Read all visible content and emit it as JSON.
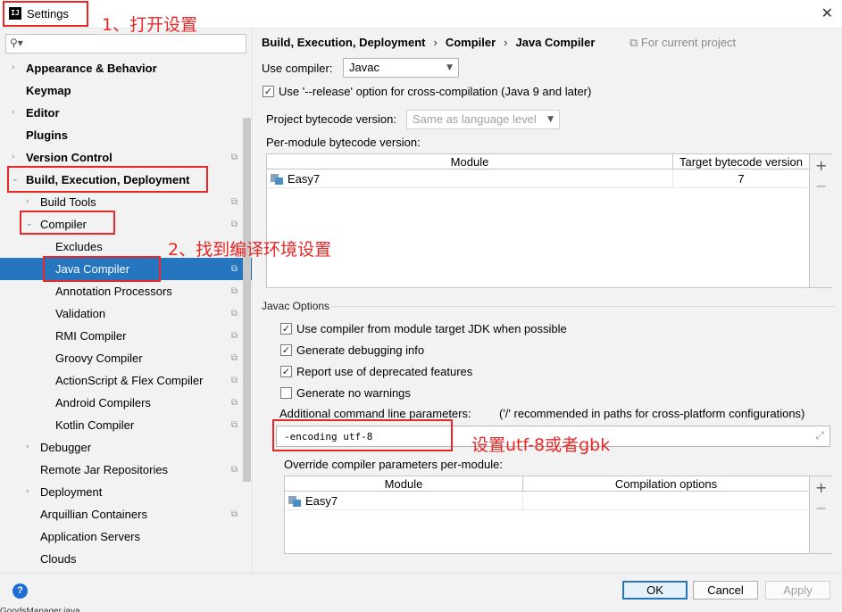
{
  "window": {
    "title": "Settings",
    "app_logo": "IJ",
    "close_glyph": "✕"
  },
  "search": {
    "placeholder": "",
    "icon": "search-icon"
  },
  "sidebar": {
    "items": [
      {
        "label": "Appearance & Behavior",
        "bold": true,
        "arrow": "›"
      },
      {
        "label": "Keymap",
        "bold": true
      },
      {
        "label": "Editor",
        "bold": true,
        "arrow": "›"
      },
      {
        "label": "Plugins",
        "bold": true
      },
      {
        "label": "Version Control",
        "bold": true,
        "arrow": "›"
      },
      {
        "label": "Build, Execution, Deployment",
        "bold": true,
        "arrow": "⌄"
      },
      {
        "label": "Build Tools",
        "arrow": "›"
      },
      {
        "label": "Compiler",
        "arrow": "⌄"
      },
      {
        "label": "Excludes"
      },
      {
        "label": "Java Compiler",
        "selected": true
      },
      {
        "label": "Annotation Processors"
      },
      {
        "label": "Validation"
      },
      {
        "label": "RMI Compiler"
      },
      {
        "label": "Groovy Compiler"
      },
      {
        "label": "ActionScript & Flex Compiler"
      },
      {
        "label": "Android Compilers"
      },
      {
        "label": "Kotlin Compiler"
      },
      {
        "label": "Debugger",
        "arrow": "›"
      },
      {
        "label": "Remote Jar Repositories"
      },
      {
        "label": "Deployment",
        "arrow": "›"
      },
      {
        "label": "Arquillian Containers"
      },
      {
        "label": "Application Servers"
      },
      {
        "label": "Clouds"
      }
    ]
  },
  "breadcrumb": {
    "part1": "Build, Execution, Deployment",
    "part2": "Compiler",
    "part3": "Java Compiler",
    "separator": "›",
    "scope_note": "⧉ For current project"
  },
  "compiler": {
    "use_compiler_label": "Use compiler:",
    "use_compiler_value": "Javac",
    "release_option_label": "Use '--release' option for cross-compilation (Java 9 and later)",
    "release_option_checked": true,
    "project_bytecode_label": "Project bytecode version:",
    "project_bytecode_value": "Same as language level",
    "per_module_label": "Per-module bytecode version:"
  },
  "bytecode_table": {
    "headers": [
      "Module",
      "Target bytecode version"
    ],
    "rows": [
      {
        "module": "Easy7",
        "version": "7"
      }
    ]
  },
  "javac_options": {
    "section_title": "Javac Options",
    "checkboxes": [
      {
        "label": "Use compiler from module target JDK when possible",
        "checked": true
      },
      {
        "label": "Generate debugging info",
        "checked": true
      },
      {
        "label": "Report use of deprecated features",
        "checked": true
      },
      {
        "label": "Generate no warnings",
        "checked": false
      }
    ],
    "additional_params_label": "Additional command line parameters:",
    "additional_params_hint": "('/' recommended in paths for cross-platform configurations)",
    "additional_params_value": "-encoding utf-8",
    "override_label": "Override compiler parameters per-module:"
  },
  "override_table": {
    "headers": [
      "Module",
      "Compilation options"
    ],
    "rows": [
      {
        "module": "Easy7",
        "options": ""
      }
    ]
  },
  "table_tools": {
    "add": "+",
    "remove": "−"
  },
  "buttons": {
    "ok": "OK",
    "cancel": "Cancel",
    "apply": "Apply",
    "help": "?"
  },
  "annotations": {
    "step1": "1、打开设置",
    "step2": "2、找到编译环境设置",
    "step3": "设置utf-8或者gbk",
    "color": "#ea2727"
  },
  "bottom_text": "GoodsManager.java"
}
